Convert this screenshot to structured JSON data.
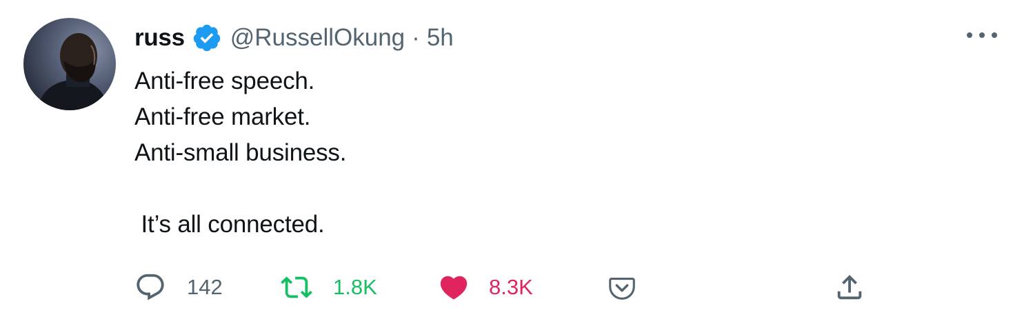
{
  "author": {
    "name": "russ",
    "handle": "@RussellOkung",
    "separator": "·",
    "time": "5h",
    "verified": true
  },
  "tweet": {
    "lines": [
      "Anti-free speech.",
      "Anti-free market.",
      "Anti-small business.",
      "",
      " It’s all connected."
    ]
  },
  "actions": {
    "reply_count": "142",
    "retweet_count": "1.8K",
    "like_count": "8.3K"
  },
  "icons": {
    "more": "more-horizontal-icon",
    "reply": "reply-icon",
    "retweet": "retweet-icon",
    "like": "heart-icon",
    "pocket": "pocket-icon",
    "share": "share-icon",
    "verified": "verified-badge-icon"
  },
  "colors": {
    "verified_blue": "#1d9bf0",
    "retweet_green": "#17bf63",
    "like_red": "#e0245e",
    "secondary_text": "#536471"
  }
}
